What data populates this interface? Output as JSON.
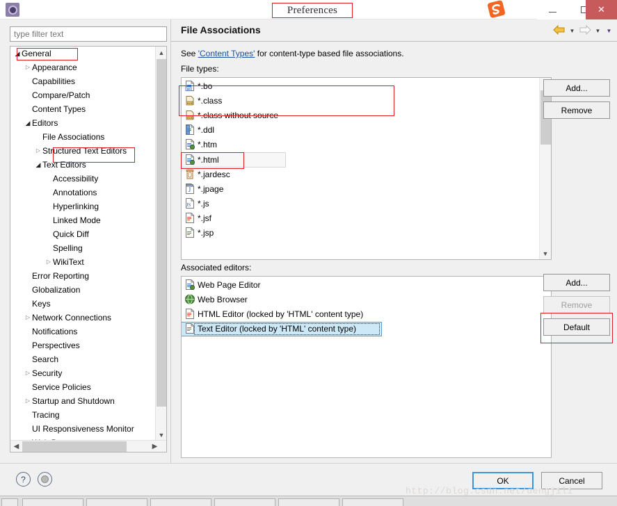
{
  "window": {
    "title": "Preferences",
    "app_icon": "preferences-gear-icon",
    "ime_logo": "sogou-logo",
    "minimize": "–",
    "maximize": "☐",
    "close": "✕"
  },
  "sidebar": {
    "filter_placeholder": "type filter text",
    "filter_value": "",
    "tree": [
      {
        "label": "General",
        "indent": 0,
        "twisty": "open",
        "annotated": true
      },
      {
        "label": "Appearance",
        "indent": 1,
        "twisty": "closed",
        "annotated": false
      },
      {
        "label": "Capabilities",
        "indent": 1,
        "twisty": "none",
        "annotated": false
      },
      {
        "label": "Compare/Patch",
        "indent": 1,
        "twisty": "none",
        "annotated": false
      },
      {
        "label": "Content Types",
        "indent": 1,
        "twisty": "none",
        "annotated": false
      },
      {
        "label": "Editors",
        "indent": 1,
        "twisty": "open",
        "annotated": false
      },
      {
        "label": "File Associations",
        "indent": 2,
        "twisty": "none",
        "annotated": true
      },
      {
        "label": "Structured Text Editors",
        "indent": 2,
        "twisty": "closed",
        "annotated": false
      },
      {
        "label": "Text Editors",
        "indent": 2,
        "twisty": "open",
        "annotated": false
      },
      {
        "label": "Accessibility",
        "indent": 3,
        "twisty": "none",
        "annotated": false
      },
      {
        "label": "Annotations",
        "indent": 3,
        "twisty": "none",
        "annotated": false
      },
      {
        "label": "Hyperlinking",
        "indent": 3,
        "twisty": "none",
        "annotated": false
      },
      {
        "label": "Linked Mode",
        "indent": 3,
        "twisty": "none",
        "annotated": false
      },
      {
        "label": "Quick Diff",
        "indent": 3,
        "twisty": "none",
        "annotated": false
      },
      {
        "label": "Spelling",
        "indent": 3,
        "twisty": "none",
        "annotated": false
      },
      {
        "label": "WikiText",
        "indent": 3,
        "twisty": "closed",
        "annotated": false
      },
      {
        "label": "Error Reporting",
        "indent": 1,
        "twisty": "none",
        "annotated": false
      },
      {
        "label": "Globalization",
        "indent": 1,
        "twisty": "none",
        "annotated": false
      },
      {
        "label": "Keys",
        "indent": 1,
        "twisty": "none",
        "annotated": false
      },
      {
        "label": "Network Connections",
        "indent": 1,
        "twisty": "closed",
        "annotated": false
      },
      {
        "label": "Notifications",
        "indent": 1,
        "twisty": "none",
        "annotated": false
      },
      {
        "label": "Perspectives",
        "indent": 1,
        "twisty": "none",
        "annotated": false
      },
      {
        "label": "Search",
        "indent": 1,
        "twisty": "none",
        "annotated": false
      },
      {
        "label": "Security",
        "indent": 1,
        "twisty": "closed",
        "annotated": false
      },
      {
        "label": "Service Policies",
        "indent": 1,
        "twisty": "none",
        "annotated": false
      },
      {
        "label": "Startup and Shutdown",
        "indent": 1,
        "twisty": "closed",
        "annotated": false
      },
      {
        "label": "Tracing",
        "indent": 1,
        "twisty": "none",
        "annotated": false
      },
      {
        "label": "UI Responsiveness Monitor",
        "indent": 1,
        "twisty": "none",
        "annotated": false
      },
      {
        "label": "Web Browser",
        "indent": 1,
        "twisty": "none",
        "annotated": false
      }
    ]
  },
  "page": {
    "title": "File Associations",
    "description_before": "See ",
    "description_link": "'Content Types'",
    "description_after": " for content-type based file associations.",
    "file_types_label": "File types:",
    "associated_editors_label": "Associated editors:",
    "nav": {
      "back_icon": "back-arrow-icon",
      "back_menu_icon": "chevron-down-icon",
      "forward_icon": "forward-arrow-icon",
      "forward_menu_icon": "chevron-down-icon",
      "view_menu_icon": "chevron-down-icon"
    }
  },
  "file_types": {
    "items": [
      {
        "label": "*.bo",
        "icon": "bo-file-icon",
        "state": "normal"
      },
      {
        "label": "*.class",
        "icon": "class-file-icon",
        "state": "normal"
      },
      {
        "label": "*.class without source",
        "icon": "class-file-icon",
        "state": "normal"
      },
      {
        "label": "*.ddl",
        "icon": "ddl-file-icon",
        "state": "normal"
      },
      {
        "label": "*.htm",
        "icon": "html-file-icon",
        "state": "normal"
      },
      {
        "label": "*.html",
        "icon": "html-file-icon",
        "state": "hover"
      },
      {
        "label": "*.jardesc",
        "icon": "jar-file-icon",
        "state": "normal"
      },
      {
        "label": "*.jpage",
        "icon": "jpage-file-icon",
        "state": "normal"
      },
      {
        "label": "*.js",
        "icon": "js-file-icon",
        "state": "normal"
      },
      {
        "label": "*.jsf",
        "icon": "jsf-file-icon",
        "state": "normal"
      },
      {
        "label": "*.jsp",
        "icon": "jsp-file-icon",
        "state": "normal"
      }
    ],
    "buttons": {
      "add": "Add...",
      "remove": "Remove"
    }
  },
  "associated_editors": {
    "items": [
      {
        "label": "Web Page Editor",
        "icon": "web-page-editor-icon",
        "state": "normal"
      },
      {
        "label": "Web Browser",
        "icon": "globe-icon",
        "state": "normal"
      },
      {
        "label": "HTML Editor (locked by 'HTML' content type)",
        "icon": "html-editor-icon",
        "state": "normal"
      },
      {
        "label": "Text Editor (locked by 'HTML' content type)",
        "icon": "text-editor-icon",
        "state": "selected"
      }
    ],
    "buttons": {
      "add": "Add...",
      "remove": "Remove",
      "default": "Default"
    }
  },
  "footer": {
    "help_icon": "question-mark-icon",
    "restore_icon": "restore-defaults-icon",
    "ok": "OK",
    "cancel": "Cancel",
    "watermark": "http://blog.csdn.net/dengjili"
  },
  "colors": {
    "accent_blue": "#3c93d8",
    "selection_fill": "#cde8f7",
    "selection_border": "#5a9fd4",
    "annotation_red": "#e01b24",
    "link": "#1a4fa0",
    "close_red": "#c75b5b"
  }
}
